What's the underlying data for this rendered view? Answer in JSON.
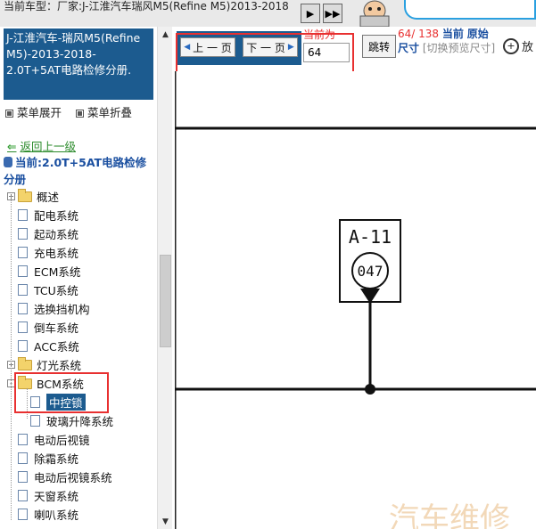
{
  "topbar": {
    "car_info": "当前车型：厂家:J-江淮汽车瑞风M5(Refine M5)2013-2018"
  },
  "sidebar": {
    "title": "J-江淮汽车-瑞风M5(Refine M5)-2013-2018- 2.0T+5AT电路检修分册.",
    "expand_label": "菜单展开",
    "collapse_label": "菜单折叠",
    "back_label": "返回上一级",
    "current_label": "当前:2.0T+5AT电路检修分册",
    "tree": [
      {
        "label": "概述",
        "type": "folder",
        "expander": "+"
      },
      {
        "label": "配电系统",
        "type": "doc"
      },
      {
        "label": "起动系统",
        "type": "doc"
      },
      {
        "label": "充电系统",
        "type": "doc"
      },
      {
        "label": "ECM系统",
        "type": "doc"
      },
      {
        "label": "TCU系统",
        "type": "doc"
      },
      {
        "label": "选换挡机构",
        "type": "doc"
      },
      {
        "label": "倒车系统",
        "type": "doc"
      },
      {
        "label": "ACC系统",
        "type": "doc"
      },
      {
        "label": "灯光系统",
        "type": "folder",
        "expander": "+"
      },
      {
        "label": "BCM系统",
        "type": "folder-open",
        "expander": "-"
      },
      {
        "label": "中控锁",
        "type": "doc",
        "child": true,
        "selected": true
      },
      {
        "label": "玻璃升降系统",
        "type": "doc",
        "child": true
      },
      {
        "label": "电动后视镜",
        "type": "doc"
      },
      {
        "label": "除霜系统",
        "type": "doc"
      },
      {
        "label": "电动后视镜系统",
        "type": "doc"
      },
      {
        "label": "天窗系统",
        "type": "doc"
      },
      {
        "label": "喇叭系统",
        "type": "doc"
      }
    ]
  },
  "toolbar": {
    "prev_label": "上 一 页",
    "next_label": "下 一 页",
    "current_page_label": "当前为",
    "page_value": "64",
    "jump_label": "跳转",
    "page_status": "64/ 138",
    "status_current": "当前",
    "status_original": "原始",
    "status_size": "尺寸",
    "status_preview": "[切换预览尺寸]",
    "zoom_label": "放"
  },
  "diagram": {
    "connector_label": "A-11",
    "pin_label": "047"
  }
}
